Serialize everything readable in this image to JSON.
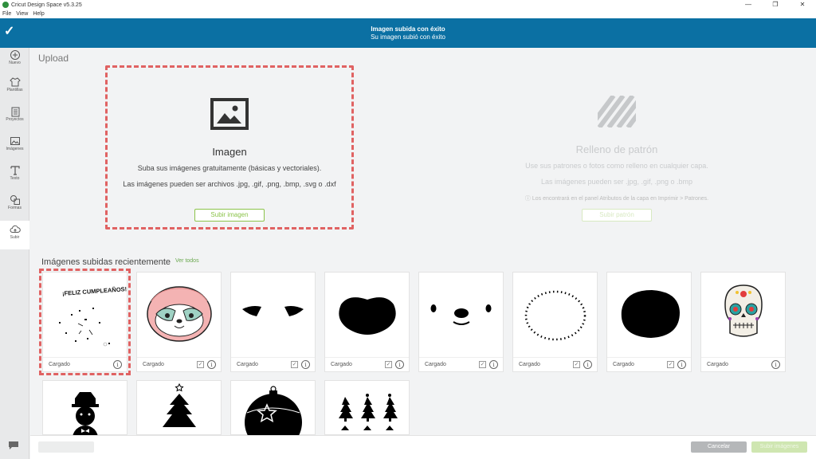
{
  "window": {
    "title": "Cricut Design Space  v5.3.25",
    "controls": [
      "—",
      "❐",
      "✕"
    ]
  },
  "menu": [
    "File",
    "View",
    "Help"
  ],
  "notification": {
    "title": "Imagen subida con éxito",
    "subtitle": "Su imagen subió con éxito"
  },
  "sidebar": {
    "items": [
      {
        "label": "Nuevo",
        "icon": "plus-circle-icon"
      },
      {
        "label": "Plantillas",
        "icon": "shirt-icon"
      },
      {
        "label": "Proyectos",
        "icon": "projects-icon"
      },
      {
        "label": "Imágenes",
        "icon": "image-icon"
      },
      {
        "label": "Texto",
        "icon": "text-icon"
      },
      {
        "label": "Formas",
        "icon": "shapes-icon"
      },
      {
        "label": "Subir",
        "icon": "upload-cloud-icon"
      }
    ]
  },
  "page": {
    "title": "Upload"
  },
  "image_card": {
    "title": "Imagen",
    "line1": "Suba sus imágenes gratuitamente (básicas y vectoriales).",
    "line2": "Las imágenes pueden ser archivos .jpg, .gif, .png, .bmp, .svg o .dxf",
    "button": "Subir imagen"
  },
  "pattern_card": {
    "title": "Relleno de patrón",
    "line1": "Use sus patrones o fotos como relleno en cualquier capa.",
    "line2": "Las imágenes pueden ser .jpg, .gif, .png o .bmp",
    "line3": "ⓘ Los encontrará en el panel Atributos de la capa en Imprimir > Patrones.",
    "button": "Subir patrón"
  },
  "recent": {
    "title": "Imágenes subidas recientemente",
    "link": "Ver todos",
    "status_label": "Cargado",
    "items": [
      {
        "name": "feliz-cumpleanos",
        "status": "Cargado",
        "text": "¡FELIZ CUMPLEAÑOS!"
      },
      {
        "name": "sloth-face",
        "status": "Cargado"
      },
      {
        "name": "eyebrows",
        "status": "Cargado"
      },
      {
        "name": "black-lips",
        "status": "Cargado"
      },
      {
        "name": "face-dots",
        "status": "Cargado"
      },
      {
        "name": "dashed-oval",
        "status": "Cargado"
      },
      {
        "name": "black-blob",
        "status": "Cargado"
      },
      {
        "name": "sugar-skull",
        "status": "Cargado"
      },
      {
        "name": "snowman",
        "status": ""
      },
      {
        "name": "christmas-tree",
        "status": ""
      },
      {
        "name": "ornament-ball",
        "status": ""
      },
      {
        "name": "trees-row",
        "status": ""
      }
    ]
  },
  "bottom": {
    "cancel": "Cancelar",
    "upload": "Subir imágenes"
  },
  "colors": {
    "header": "#0b70a3",
    "accent": "#8bc34a",
    "highlight": "#e06262"
  }
}
